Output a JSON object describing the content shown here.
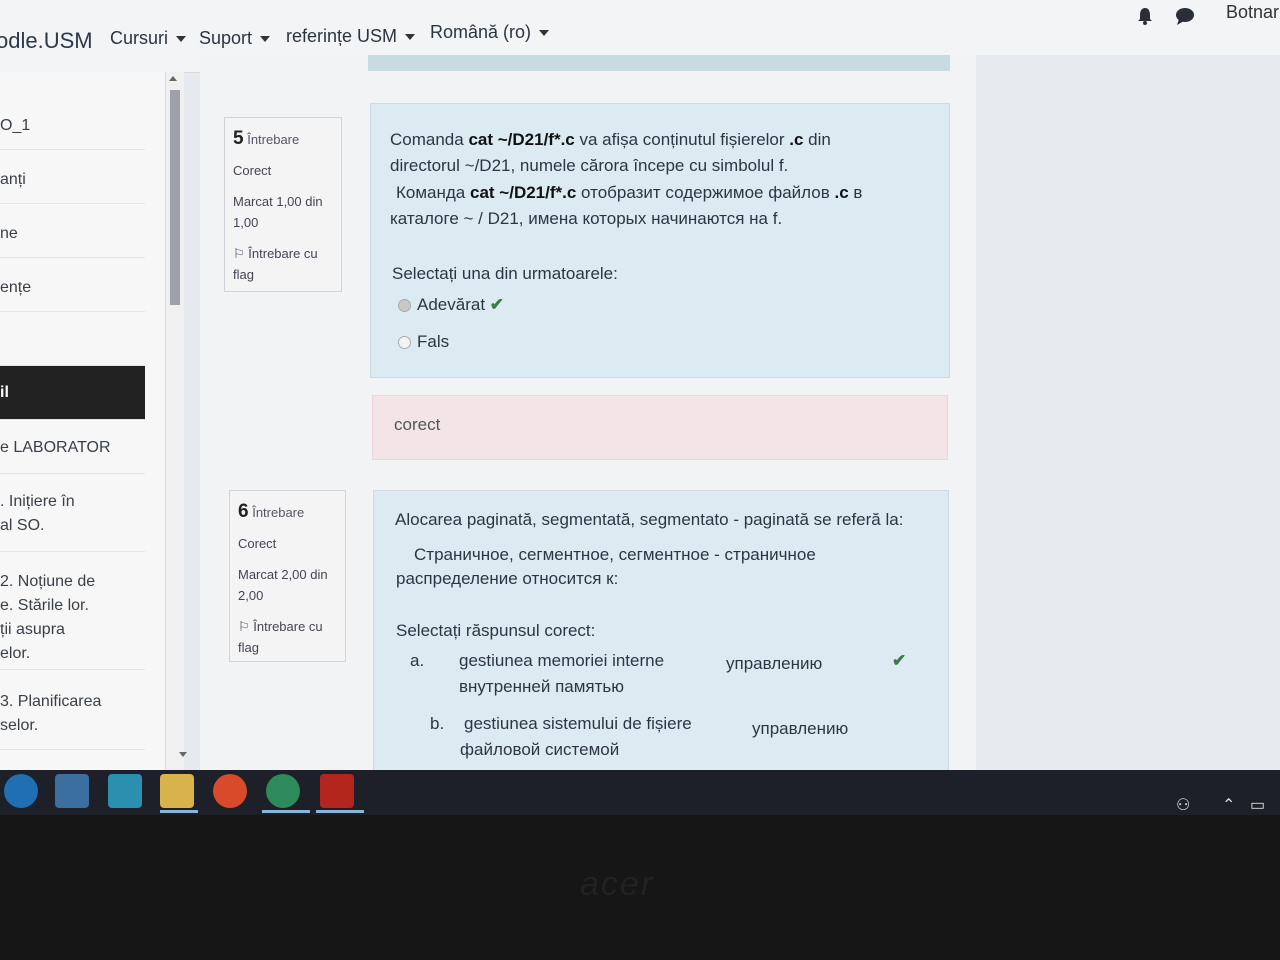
{
  "navbar": {
    "brand": "odle.USM",
    "menu": [
      {
        "label": "Cursuri"
      },
      {
        "label": "Suport"
      },
      {
        "label": "referințe USM"
      },
      {
        "label": "Română (ro)"
      }
    ],
    "user": "Botnar"
  },
  "drawer": {
    "items": [
      {
        "label": "O_1"
      },
      {
        "label": "anți"
      },
      {
        "label": "ne"
      },
      {
        "label": "ențe"
      },
      {
        "label": ""
      },
      {
        "label": "il"
      },
      {
        "label": "e LABORATOR"
      },
      {
        "label": ". Inițiere în\nal SO."
      },
      {
        "label": "2. Noțiune de\ne. Stările lor.\nții asupra\nelor."
      },
      {
        "label": "3. Planificarea\nselor."
      }
    ]
  },
  "questions": [
    {
      "number": "5",
      "word": "Întrebare",
      "state": "Corect",
      "grade": "Marcat 1,00 din 1,00",
      "flag": "Întrebare cu flag",
      "text_ro_1": [
        "Comanda ",
        "cat",
        " ~/D21/f*.c",
        " va afișa conținutul fișierelor ",
        ".c",
        " din"
      ],
      "text_ro_2": "directorul ~/D21, numele cărora începe cu simbolul f.",
      "text_ru_1": [
        "Команда ",
        "cat",
        " ~/D21/f*.c",
        " отобразит содержимое файлов ",
        ".c",
        " в"
      ],
      "text_ru_2": "каталоге ~ / D21, имена которых начинаются на f.",
      "prompt": "Selectați una din urmatoarele:",
      "options": [
        {
          "label": "Adevărat",
          "selected": true,
          "correct": true
        },
        {
          "label": "Fals",
          "selected": false,
          "correct": false
        }
      ],
      "feedback": "corect"
    },
    {
      "number": "6",
      "word": "Întrebare",
      "state": "Corect",
      "grade": "Marcat 2,00 din 2,00",
      "flag": "Întrebare cu flag",
      "text_ro": "Alocarea paginată, segmentată, segmentato - paginată se referă la:",
      "text_ru_1": "Страничное, сегментное, сегментное - страничное",
      "text_ru_2": "распределение относится к:",
      "prompt": "Selectați răspunsul corect:",
      "options": [
        {
          "letter": "a.",
          "label_ro": "gestiunea memoriei interne",
          "label_ru": "внутренней памятью",
          "match": "управлению",
          "correct": true
        },
        {
          "letter": "b.",
          "label_ro": "gestiunea sistemului de fișiere",
          "label_ru": "файловой системой",
          "match": "управлению",
          "correct": false
        }
      ]
    }
  ],
  "icons": {
    "bell": "bell-icon",
    "chat": "chat-icon",
    "flag": "flag-icon",
    "check": "check-icon"
  },
  "bezel_logo": "acer",
  "colors": {
    "formulation_bg": "#dceaf2",
    "feedback_bg": "#f2e4e7",
    "correct_green": "#3f7a4a",
    "taskbar": "#1d2028"
  }
}
